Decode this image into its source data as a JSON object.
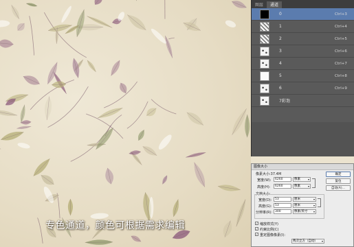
{
  "caption": "专色通道，颜色可根据需求编辑",
  "channels_panel": {
    "tabs": [
      "图层",
      "通道"
    ],
    "active_tab": 1,
    "channels": [
      {
        "name": "0",
        "shortcut": "Ctrl+3",
        "thumb": "black",
        "selected": true
      },
      {
        "name": "1",
        "shortcut": "Ctrl+4",
        "thumb": "noise",
        "selected": false
      },
      {
        "name": "2",
        "shortcut": "Ctrl+5",
        "thumb": "noise",
        "selected": false
      },
      {
        "name": "3",
        "shortcut": "Ctrl+6",
        "thumb": "spots",
        "selected": false
      },
      {
        "name": "4",
        "shortcut": "Ctrl+7",
        "thumb": "spots",
        "selected": false
      },
      {
        "name": "5",
        "shortcut": "Ctrl+8",
        "thumb": "white",
        "selected": false
      },
      {
        "name": "6",
        "shortcut": "Ctrl+9",
        "thumb": "spots",
        "selected": false
      },
      {
        "name": "7彩泡",
        "shortcut": "",
        "thumb": "spots",
        "selected": false
      }
    ]
  },
  "image_size_dialog": {
    "title": "图像大小",
    "pixel_size": "像素大小:37.4M",
    "width_label": "宽度(W):",
    "width_value": "6260",
    "height_label": "高度(H):",
    "height_value": "6260",
    "pixel_unit": "像素",
    "doc_size_label": "文档大小:",
    "doc_width_label": "宽度(D):",
    "doc_width_value": "53",
    "doc_height_label": "高度(G):",
    "doc_height_value": "53",
    "unit_cm": "厘米",
    "resolution_label": "分辨率(R):",
    "resolution_value": "300",
    "resolution_unit": "像素/英寸",
    "ok_label": "确定",
    "reset_label": "复位",
    "auto_label": "自动(A)...",
    "scale_styles_label": "缩放样式(Y)",
    "constrain_label": "约束比例(C)",
    "resample_label": "重定图像像素(I):",
    "resample_method": "两次立方（自动）"
  },
  "colors": {
    "panel_bg": "#5a5a5a",
    "selected_row": "#5b7cae",
    "leaf_purple": "#8e5c7e",
    "leaf_olive": "#b7b07a"
  }
}
